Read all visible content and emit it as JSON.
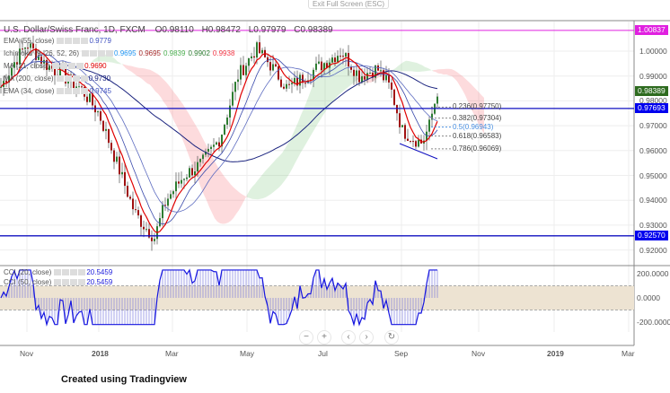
{
  "top": {
    "exit_label": "Exit Full Screen (ESC)"
  },
  "symbol": {
    "title": "U.S. Dollar/Swiss Franc, 1D, FXCM",
    "open": "O0.98110",
    "high": "H0.98472",
    "low": "L0.97979",
    "close": "C0.98389"
  },
  "indicators": [
    {
      "name": "EMA (55, close)",
      "values": [
        "0.9779"
      ],
      "colors": [
        "#3e4fc0"
      ]
    },
    {
      "name": "Ichimoku (9, 26, 52, 26)",
      "values": [
        "0.9695",
        "0.9695",
        "0.9839",
        "0.9902",
        "0.9938"
      ],
      "colors": [
        "#2196f3",
        "#a52a2a",
        "#4caf50",
        "#2e7d32",
        "#f23645"
      ]
    },
    {
      "name": "MA (21, close)",
      "values": [
        "0.9690"
      ],
      "colors": [
        "#e00000"
      ]
    },
    {
      "name": "MA (200, close)",
      "values": [
        "0.9730"
      ],
      "colors": [
        "#1a237e"
      ]
    },
    {
      "name": "EMA (34, close)",
      "values": [
        "0.9745"
      ],
      "colors": [
        "#3e4fc0"
      ]
    }
  ],
  "cci": [
    {
      "name": "CCI (20, close)",
      "value": "20.5459"
    },
    {
      "name": "CCI (50, close)",
      "value": "20.5459"
    }
  ],
  "price_axis": [
    "1.00000",
    "0.99000",
    "0.98000",
    "0.97000",
    "0.96000",
    "0.95000",
    "0.94000",
    "0.93000",
    "0.92000"
  ],
  "cci_axis": [
    "200.0000",
    "0.0000",
    "-200.0000"
  ],
  "time_axis": [
    "Nov",
    "2018",
    "Mar",
    "May",
    "Jul",
    "Sep",
    "Nov",
    "2019",
    "Mar"
  ],
  "tags": {
    "magenta": "1.00837",
    "last": "0.98389",
    "blue1": "0.97693",
    "blue2": "0.92570"
  },
  "fib": [
    "0.236(0.97750)",
    "0.382(0.97304)",
    "0.5(0.96943)",
    "0.618(0.96583)",
    "0.786(0.96069)"
  ],
  "controls": {
    "zoom_out": "−",
    "zoom_in": "+",
    "left": "‹",
    "right": "›",
    "reset": "↻"
  },
  "credit": "Created using Tradingview",
  "price_path": [
    [
      0,
      0.985
    ],
    [
      15,
      0.995
    ],
    [
      30,
      1.003
    ],
    [
      50,
      0.995
    ],
    [
      70,
      0.99
    ],
    [
      90,
      0.985
    ],
    [
      110,
      0.975
    ],
    [
      130,
      0.955
    ],
    [
      150,
      0.935
    ],
    [
      160,
      0.93
    ],
    [
      172,
      0.925
    ],
    [
      185,
      0.94
    ],
    [
      205,
      0.95
    ],
    [
      225,
      0.955
    ],
    [
      245,
      0.965
    ],
    [
      265,
      0.99
    ],
    [
      285,
      1.001
    ],
    [
      300,
      0.995
    ],
    [
      320,
      0.985
    ],
    [
      340,
      0.99
    ],
    [
      360,
      0.995
    ],
    [
      380,
      1.0
    ],
    [
      400,
      0.99
    ],
    [
      420,
      0.993
    ],
    [
      435,
      0.985
    ],
    [
      448,
      0.968
    ],
    [
      460,
      0.965
    ],
    [
      470,
      0.963
    ],
    [
      478,
      0.97
    ],
    [
      487,
      0.984
    ]
  ]
}
